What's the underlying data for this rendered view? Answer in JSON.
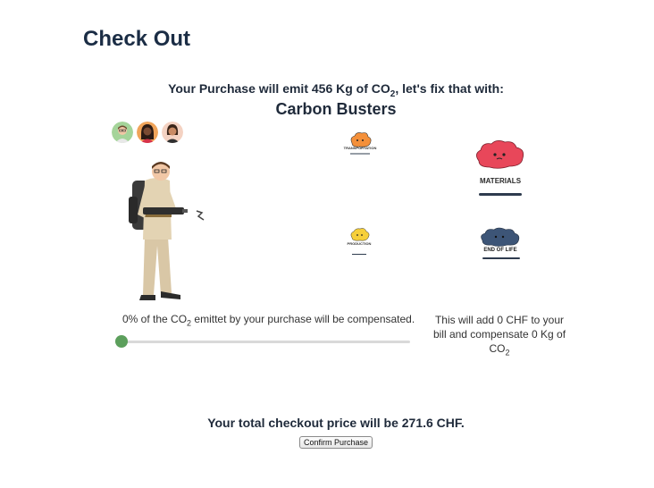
{
  "page": {
    "title": "Check Out"
  },
  "emission": {
    "prefix": "Your Purchase will emit 456 Kg of CO",
    "subscript": "2",
    "suffix": ", let's fix that with:"
  },
  "brand": {
    "name": "Carbon Busters"
  },
  "categories": {
    "transportation": "TRANSPORTATION",
    "materials": "MATERIALS",
    "production": "PRODUCTION",
    "end_of_life": "END OF LIFE"
  },
  "slider": {
    "label_prefix": "0% of the CO",
    "label_subscript": "2",
    "label_suffix": " emittet by your purchase will be compensated.",
    "percent": 0
  },
  "compensation": {
    "prefix": "This will add 0 CHF to your bill and compensate 0 Kg of CO",
    "subscript": "2"
  },
  "total": {
    "text": "Your total checkout price will be 271.6 CHF."
  },
  "confirm": {
    "label": "Confirm Purchase"
  },
  "colors": {
    "title": "#1b2d45",
    "slider_thumb": "#5c9f5c",
    "materials_cloud": "#e8475a",
    "transport_cloud": "#f4903a",
    "production_cloud": "#f6cf3a",
    "end_of_life_cloud": "#3d5577"
  }
}
